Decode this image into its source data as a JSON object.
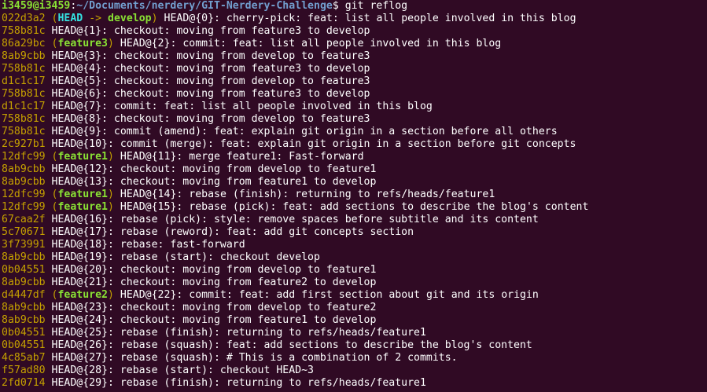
{
  "prompt": {
    "user_host": "i3459@i3459",
    "separator": ":",
    "path": "~/Documents/nerdery/GIT-Nerdery-Challenge",
    "dollar": "$",
    "command": " git reflog"
  },
  "colors": {
    "background": "#300a24",
    "hash": "#c4a000",
    "branch": "#8ae234",
    "head": "#34e2e2",
    "path": "#729fcf",
    "text": "#ffffff"
  },
  "entries": [
    {
      "hash": "022d3a2",
      "refs": [
        {
          "name": "HEAD",
          "kind": "head"
        },
        {
          "name": "develop",
          "kind": "branch"
        }
      ],
      "message": "HEAD@{0}: cherry-pick: feat: list all people involved in this blog"
    },
    {
      "hash": "758b81c",
      "refs": [],
      "message": "HEAD@{1}: checkout: moving from feature3 to develop"
    },
    {
      "hash": "86a29bc",
      "refs": [
        {
          "name": "feature3",
          "kind": "branch"
        }
      ],
      "message": "HEAD@{2}: commit: feat: list all people involved in this blog"
    },
    {
      "hash": "8ab9cbb",
      "refs": [],
      "message": "HEAD@{3}: checkout: moving from develop to feature3"
    },
    {
      "hash": "758b81c",
      "refs": [],
      "message": "HEAD@{4}: checkout: moving from feature3 to develop"
    },
    {
      "hash": "d1c1c17",
      "refs": [],
      "message": "HEAD@{5}: checkout: moving from develop to feature3"
    },
    {
      "hash": "758b81c",
      "refs": [],
      "message": "HEAD@{6}: checkout: moving from feature3 to develop"
    },
    {
      "hash": "d1c1c17",
      "refs": [],
      "message": "HEAD@{7}: commit: feat: list all people involved in this blog"
    },
    {
      "hash": "758b81c",
      "refs": [],
      "message": "HEAD@{8}: checkout: moving from develop to feature3"
    },
    {
      "hash": "758b81c",
      "refs": [],
      "message": "HEAD@{9}: commit (amend): feat: explain git origin in a section before all others"
    },
    {
      "hash": "2c927b1",
      "refs": [],
      "message": "HEAD@{10}: commit (merge): feat: explain git origin in a section before git concepts"
    },
    {
      "hash": "12dfc99",
      "refs": [
        {
          "name": "feature1",
          "kind": "branch"
        }
      ],
      "message": "HEAD@{11}: merge feature1: Fast-forward"
    },
    {
      "hash": "8ab9cbb",
      "refs": [],
      "message": "HEAD@{12}: checkout: moving from develop to feature1"
    },
    {
      "hash": "8ab9cbb",
      "refs": [],
      "message": "HEAD@{13}: checkout: moving from feature1 to develop"
    },
    {
      "hash": "12dfc99",
      "refs": [
        {
          "name": "feature1",
          "kind": "branch"
        }
      ],
      "message": "HEAD@{14}: rebase (finish): returning to refs/heads/feature1"
    },
    {
      "hash": "12dfc99",
      "refs": [
        {
          "name": "feature1",
          "kind": "branch"
        }
      ],
      "message": "HEAD@{15}: rebase (pick): feat: add sections to describe the blog's content"
    },
    {
      "hash": "67caa2f",
      "refs": [],
      "message": "HEAD@{16}: rebase (pick): style: remove spaces before subtitle and its content"
    },
    {
      "hash": "5c70671",
      "refs": [],
      "message": "HEAD@{17}: rebase (reword): feat: add git concepts section"
    },
    {
      "hash": "3f73991",
      "refs": [],
      "message": "HEAD@{18}: rebase: fast-forward"
    },
    {
      "hash": "8ab9cbb",
      "refs": [],
      "message": "HEAD@{19}: rebase (start): checkout develop"
    },
    {
      "hash": "0b04551",
      "refs": [],
      "message": "HEAD@{20}: checkout: moving from develop to feature1"
    },
    {
      "hash": "8ab9cbb",
      "refs": [],
      "message": "HEAD@{21}: checkout: moving from feature2 to develop"
    },
    {
      "hash": "d4447df",
      "refs": [
        {
          "name": "feature2",
          "kind": "branch"
        }
      ],
      "message": "HEAD@{22}: commit: feat: add first section about git and its origin"
    },
    {
      "hash": "8ab9cbb",
      "refs": [],
      "message": "HEAD@{23}: checkout: moving from develop to feature2"
    },
    {
      "hash": "8ab9cbb",
      "refs": [],
      "message": "HEAD@{24}: checkout: moving from feature1 to develop"
    },
    {
      "hash": "0b04551",
      "refs": [],
      "message": "HEAD@{25}: rebase (finish): returning to refs/heads/feature1"
    },
    {
      "hash": "0b04551",
      "refs": [],
      "message": "HEAD@{26}: rebase (squash): feat: add sections to describe the blog's content"
    },
    {
      "hash": "4c85ab7",
      "refs": [],
      "message": "HEAD@{27}: rebase (squash): # This is a combination of 2 commits."
    },
    {
      "hash": "f57ad80",
      "refs": [],
      "message": "HEAD@{28}: rebase (start): checkout HEAD~3"
    },
    {
      "hash": "2fd0714",
      "refs": [],
      "message": "HEAD@{29}: rebase (finish): returning to refs/heads/feature1"
    }
  ]
}
